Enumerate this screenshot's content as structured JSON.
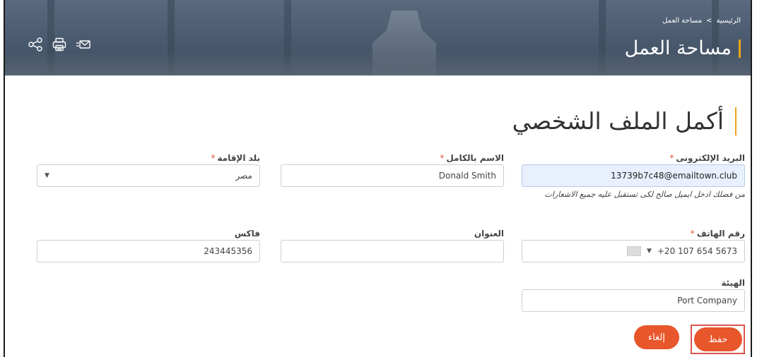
{
  "breadcrumb": {
    "home": "الرئيسية",
    "separator": ">",
    "current": "مساحة العمل"
  },
  "banner": {
    "title": "مساحة العمل",
    "icons": [
      "share-icon",
      "print-icon",
      "email-icon"
    ]
  },
  "section": {
    "title": "أكمل الملف الشخصي"
  },
  "form": {
    "email": {
      "label": "البريد الإلكترونى",
      "required": "*",
      "value": "13739b7c48@emailtown.club",
      "help": "من فضلك ادخل ايميل صالح لكى تستقبل عليه جميع الاشعارات"
    },
    "full_name": {
      "label": "الاسم بالكامل",
      "required": "*",
      "value": "Donald Smith"
    },
    "country": {
      "label": "بلد الإقامة",
      "required": "*",
      "value": "مصر"
    },
    "phone": {
      "label": "رقم الهاتف",
      "required": "*",
      "value": "+20 107 654 5673"
    },
    "address": {
      "label": "العنوان",
      "value": ""
    },
    "fax": {
      "label": "فاكس",
      "value": "243445356"
    },
    "organization": {
      "label": "الهيئة",
      "value": "Port Company"
    }
  },
  "buttons": {
    "save": "حفظ",
    "cancel": "إلغاء"
  },
  "colors": {
    "accent": "#e8562b",
    "title_bar": "#f0a31a",
    "banner": "#4f5f73"
  }
}
